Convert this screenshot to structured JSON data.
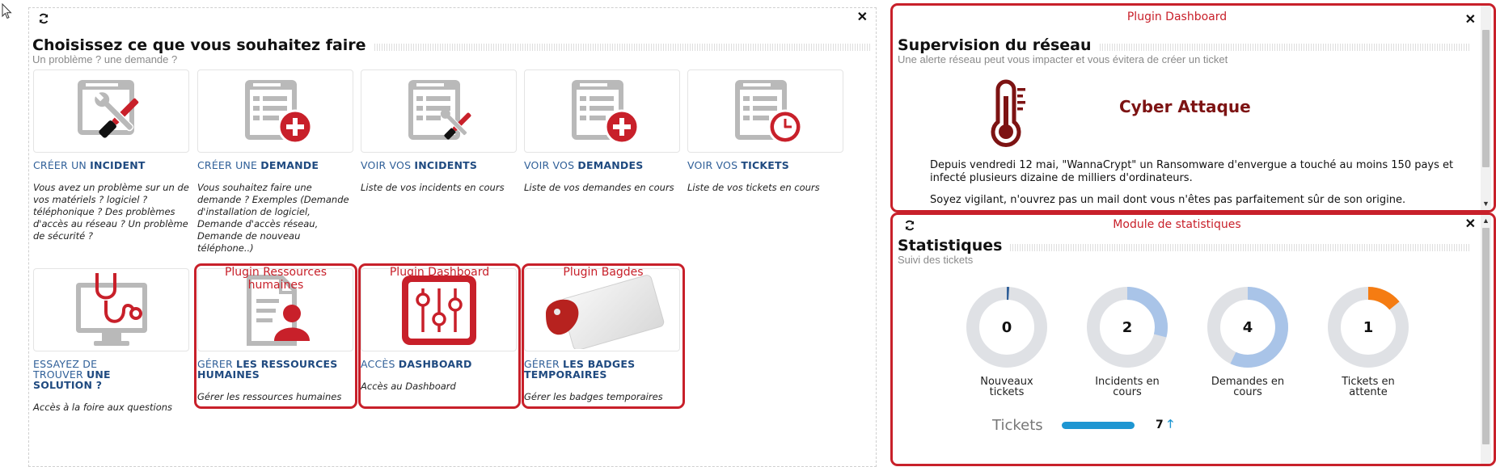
{
  "left_panel": {
    "refresh_icon": "refresh-icon",
    "close_label": "✕",
    "title": "Choisissez ce que vous souhaitez faire",
    "subtitle": "Un problème ? une demande ?",
    "tiles": [
      {
        "icon": "create-incident-icon",
        "label_prefix": "Créer un ",
        "label_bold": "Incident",
        "description": "Vous avez un problème sur un de vos matériels ? logiciel ? téléphonique ? Des problèmes d'accès au réseau ? Un problème de sécurité ?"
      },
      {
        "icon": "create-request-icon",
        "label_prefix": "Créer une ",
        "label_bold": "Demande",
        "description": "Vous souhaitez faire une demande ? Exemples (Demande d'installation de logiciel, Demande d'accès réseau, Demande de nouveau téléphone..)"
      },
      {
        "icon": "view-incidents-icon",
        "label_prefix": "Voir vos ",
        "label_bold": "Incidents",
        "description": "Liste de vos incidents en cours"
      },
      {
        "icon": "view-requests-icon",
        "label_prefix": "Voir vos ",
        "label_bold": "Demandes",
        "description": "Liste de vos demandes en cours"
      },
      {
        "icon": "view-tickets-icon",
        "label_prefix": "Voir vos ",
        "label_bold": "Tickets",
        "description": "Liste de vos tickets en cours"
      },
      {
        "icon": "stethoscope-monitor-icon",
        "label_prefix": "Essayez de trouver ",
        "label_bold": "une solution ?",
        "description": "Accès à la foire aux questions"
      },
      {
        "icon": "human-resources-icon",
        "label_prefix": "Gérer ",
        "label_bold": "les ressources humaines",
        "description": "Gérer les ressources humaines"
      },
      {
        "icon": "dashboard-sliders-icon",
        "label_prefix": "Accès ",
        "label_bold": "Dashboard",
        "description": "Accès au Dashboard"
      },
      {
        "icon": "badge-card-icon",
        "label_prefix": "Gérer ",
        "label_bold": "les badges temporaires",
        "description": "Gérer les badges temporaires"
      }
    ],
    "plugins": [
      {
        "label": "Plugin Ressources humaines"
      },
      {
        "label": "Plugin Dashboard"
      },
      {
        "label": "Plugin Bagdes"
      }
    ]
  },
  "network_panel": {
    "plugin_label": "Plugin Dashboard",
    "close_label": "✕",
    "title": "Supervision du réseau",
    "subtitle": "Une alerte réseau peut vous impacter et vous évitera de créer un ticket",
    "alert_icon": "thermometer-icon",
    "alert_title": "Cyber Attaque",
    "alert_paragraph_1": "Depuis vendredi 12 mai, \"WannaCrypt\" un Ransomware d'envergue a touché au moins 150 pays et infecté plusieurs dizaine de milliers d'ordinateurs.",
    "alert_paragraph_2": "Soyez vigilant, n'ouvrez pas un mail dont vous n'êtes pas parfaitement sûr de son origine."
  },
  "stats_panel": {
    "module_label": "Module de statistiques",
    "refresh_icon": "refresh-icon",
    "close_label": "✕",
    "title": "Statistiques",
    "subtitle": "Suivi des tickets",
    "donuts": [
      {
        "value": "0",
        "label_line1": "Nouveaux",
        "label_line2": "tickets",
        "fill": 0.01,
        "color": "#2f5f98"
      },
      {
        "value": "2",
        "label_line1": "Incidents en",
        "label_line2": "cours",
        "fill": 0.29,
        "color": "#a9c4e8"
      },
      {
        "value": "4",
        "label_line1": "Demandes en",
        "label_line2": "cours",
        "fill": 0.57,
        "color": "#a9c4e8"
      },
      {
        "value": "1",
        "label_line1": "Tickets en",
        "label_line2": "attente",
        "fill": 0.14,
        "color": "#f57c12"
      }
    ],
    "tickets_label": "Tickets",
    "tickets_count": "7",
    "tickets_trend": "up-arrow-icon"
  },
  "colors": {
    "plugin_red": "#c8202a",
    "icon_red": "#c8202a",
    "icon_gray": "#b9b9b9",
    "link_blue": "#2f5f98",
    "alert_red": "#7d1313"
  }
}
